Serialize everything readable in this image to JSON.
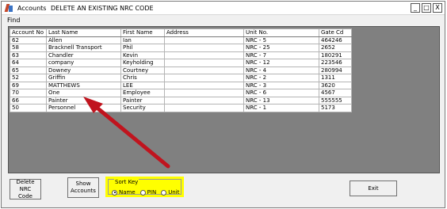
{
  "window": {
    "app_name": "Accounts",
    "title": "DELETE AN EXISTING NRC CODE",
    "controls": {
      "minimize": "_",
      "maximize": "□",
      "close": "X"
    }
  },
  "menu": {
    "find": "Find"
  },
  "table": {
    "columns": [
      "Account No",
      "Last Name",
      "First Name",
      "Address",
      "Unit No.",
      "Gate Cd"
    ],
    "rows": [
      [
        "62",
        "Allen",
        "Ian",
        "",
        "NRC - 5",
        "464246"
      ],
      [
        "58",
        "Bracknell Transport",
        "Phil",
        "",
        "NRC - 25",
        "2652"
      ],
      [
        "63",
        "Chandler",
        "Kevin",
        "",
        "NRC - 7",
        "180291"
      ],
      [
        "64",
        "company",
        "Keyholding",
        "",
        "NRC - 12",
        "223546"
      ],
      [
        "65",
        "Downey",
        "Courtney",
        "",
        "NRC - 4",
        "280994"
      ],
      [
        "52",
        "Griffin",
        "Chris",
        "",
        "NRC - 2",
        "1311"
      ],
      [
        "69",
        "MATTHEWS",
        "LEE",
        "",
        "NRC - 3",
        "3620"
      ],
      [
        "70",
        "One",
        "Employee",
        "",
        "NRC - 6",
        "4567"
      ],
      [
        "66",
        "Painter",
        "Painter",
        "",
        "NRC - 13",
        "555555"
      ],
      [
        "50",
        "Personnel",
        "Security",
        "",
        "NRC - 1",
        "5173"
      ]
    ]
  },
  "buttons": {
    "delete_line1": "Delete NRC",
    "delete_line2": "Code",
    "show_line1": "Show",
    "show_line2": "Accounts",
    "exit": "Exit"
  },
  "sort_key": {
    "legend": "Sort Key",
    "options": [
      "Name",
      "PIN",
      "Unit"
    ],
    "selected": "Name"
  },
  "colors": {
    "highlight": "#ffff00",
    "arrow": "#c0141e",
    "grid_bg": "#808080"
  }
}
